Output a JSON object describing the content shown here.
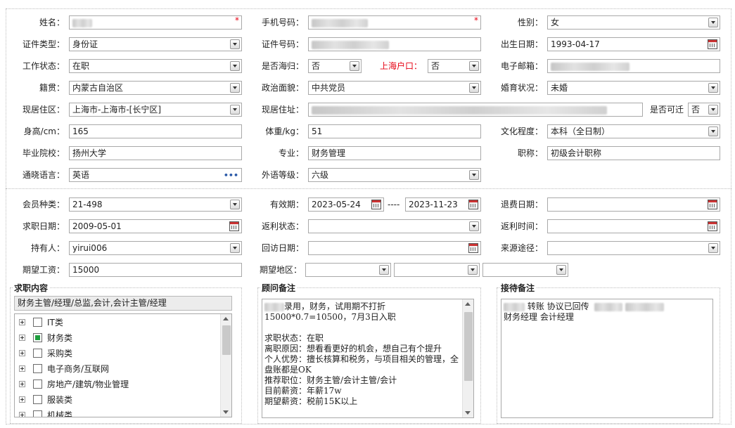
{
  "fields": {
    "name_label": "姓名：",
    "phone_label": "手机号码：",
    "gender_label": "性别：",
    "gender": "女",
    "id_type_label": "证件类型：",
    "id_type": "身份证",
    "id_no_label": "证件号码：",
    "birth_label": "出生日期：",
    "birth": "1993-04-17",
    "work_status_label": "工作状态：",
    "work_status": "在职",
    "returnee_label": "是否海归：",
    "returnee": "否",
    "shanghai_hukou_label": "上海户口：",
    "shanghai_hukou": "否",
    "email_label": "电子邮箱：",
    "native_label": "籍贯：",
    "native": "内蒙古自治区",
    "political_label": "政治面貌：",
    "political": "中共党员",
    "marital_label": "婚育状况：",
    "marital": "未婚",
    "residence_label": "现居住区：",
    "residence": "上海市-上海市-[长宁区]",
    "address_label": "现居住址：",
    "relocate_label": "是否可迁",
    "relocate": "否",
    "height_label": "身高/cm：",
    "height": "165",
    "weight_label": "体重/kg：",
    "weight": "51",
    "education_label": "文化程度：",
    "education": "本科（全日制）",
    "school_label": "毕业院校：",
    "school": "扬州大学",
    "major_label": "专业：",
    "major": "财务管理",
    "title_label": "职称：",
    "title": "初级会计职称",
    "language_label": "通晓语言：",
    "language": "英语",
    "foreign_level_label": "外语等级：",
    "foreign_level": "六级",
    "member_type_label": "会员种类：",
    "member_type": "21-498",
    "valid_label": "有效期：",
    "valid_from": "2023-05-24",
    "valid_sep": "----",
    "valid_to": "2023-11-23",
    "refund_date_label": "退费日期：",
    "apply_date_label": "求职日期：",
    "apply_date": "2009-05-01",
    "rebate_status_label": "返利状态：",
    "rebate_time_label": "返利时间：",
    "holder_label": "持有人：",
    "holder": "yirui006",
    "visit_date_label": "回访日期：",
    "source_label": "来源途径：",
    "salary_label": "期望工资：",
    "salary": "15000",
    "region_label": "期望地区："
  },
  "job_panel": {
    "title": "求职内容",
    "summary": "财务主管/经理/总监,会计,会计主管/经理",
    "categories": [
      {
        "label": "IT类",
        "checked": false
      },
      {
        "label": "财务类",
        "checked": true
      },
      {
        "label": "采购类",
        "checked": false
      },
      {
        "label": "电子商务/互联网",
        "checked": false
      },
      {
        "label": "房地产/建筑/物业管理",
        "checked": false
      },
      {
        "label": "服装类",
        "checked": false
      },
      {
        "label": "机械类",
        "checked": false
      }
    ]
  },
  "advisor_panel": {
    "title": "顾问备注",
    "text": "录用，财务，试用期不打折15000*0.7=10500，7月3日入职\n\n求职状态：在职\n离职原因：想看看更好的机会，想自己有个提升\n个人优势：擅长核算和税务，与项目相关的管理，全盘账都是OK\n推荐职位：财务主管/会计主管/会计\n目前薪资：年薪17w\n期望薪资：税前15K以上"
  },
  "reception_panel": {
    "title": "接待备注",
    "line1": "转账 协议已回传",
    "line2": "财务经理 会计经理"
  }
}
